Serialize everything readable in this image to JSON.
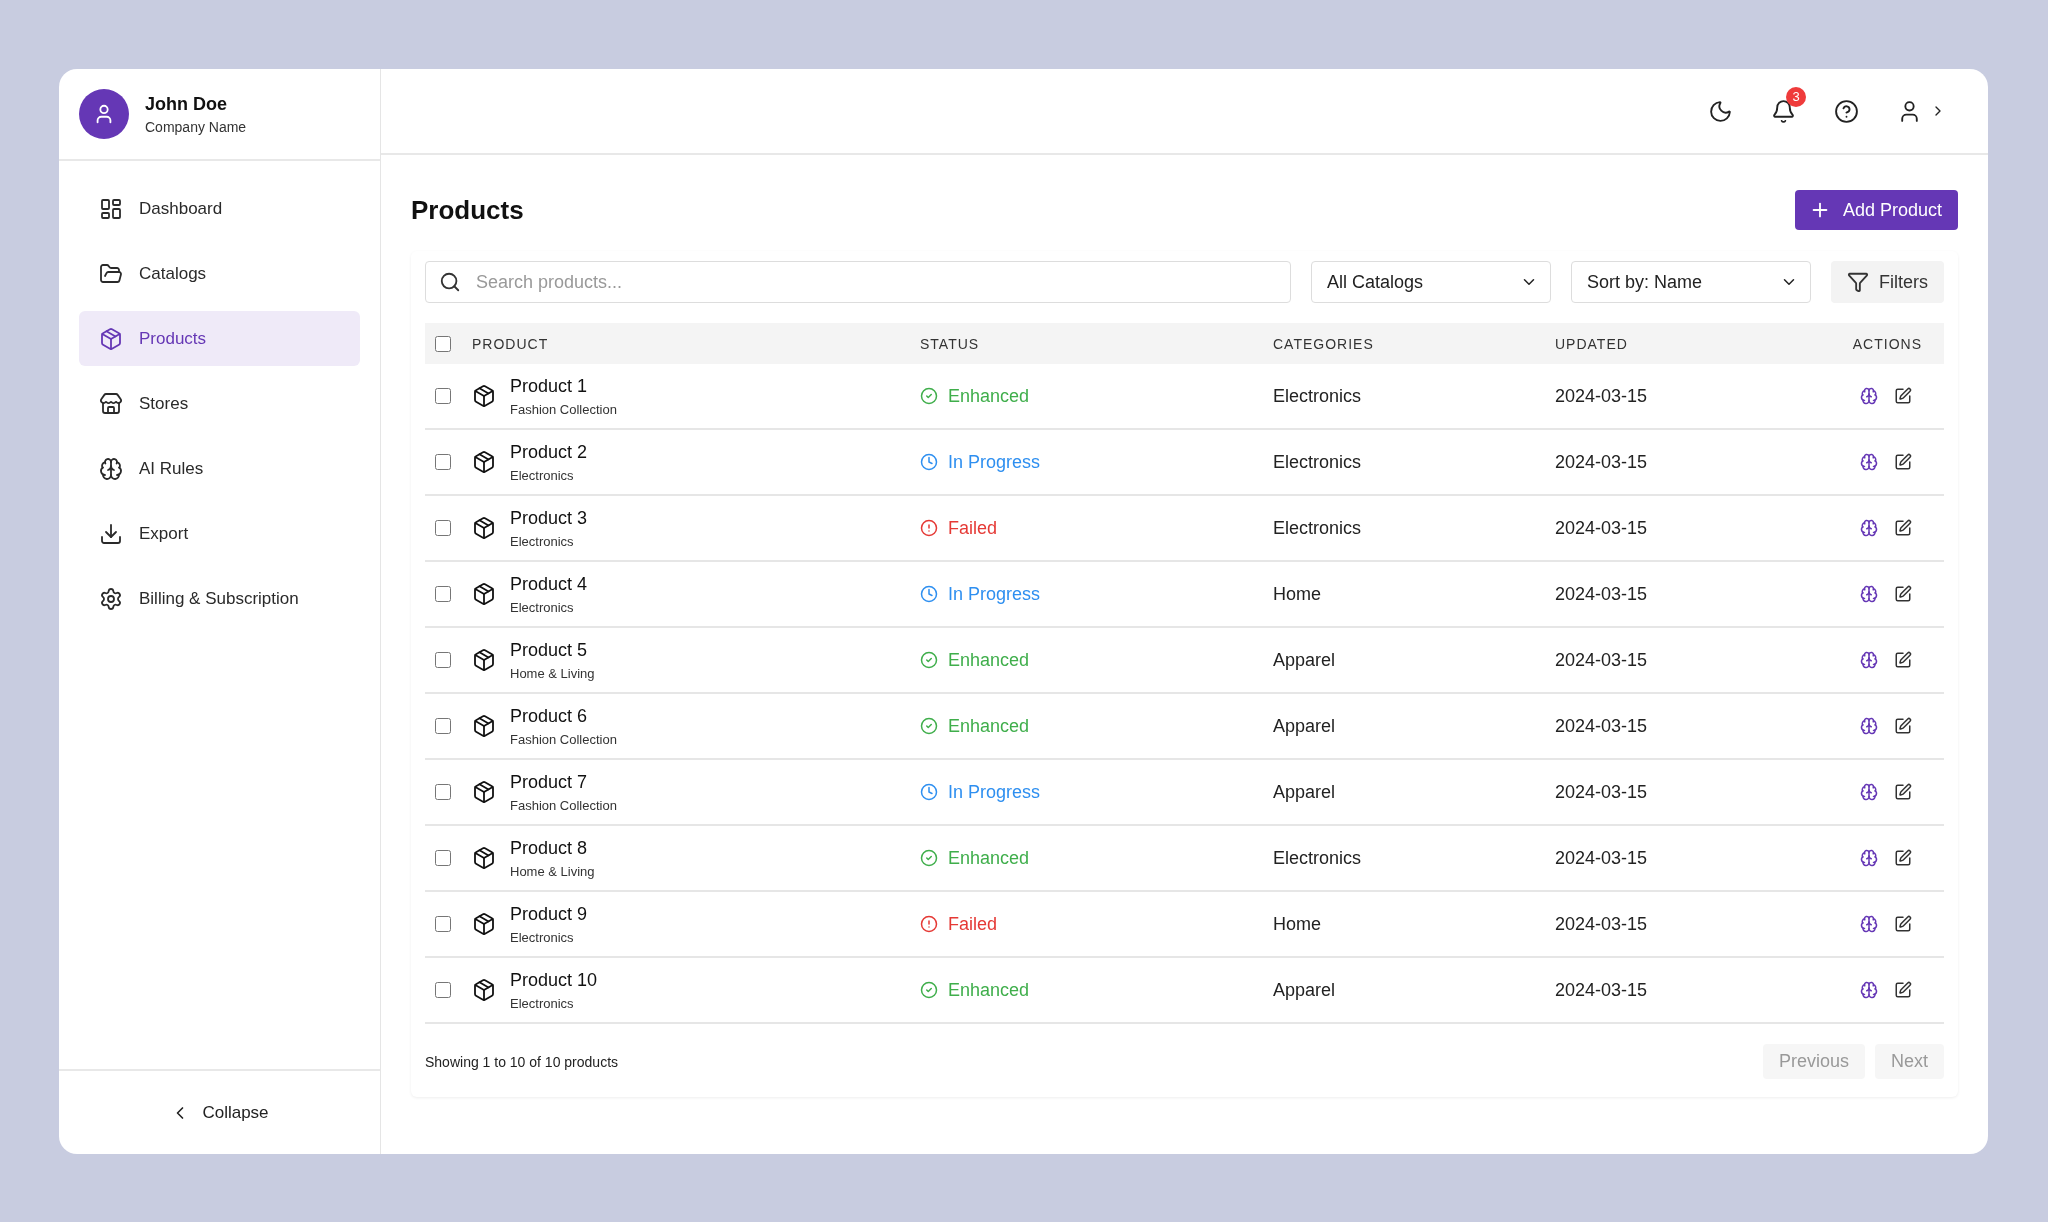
{
  "user": {
    "name": "John Doe",
    "company": "Company Name"
  },
  "sidebar": {
    "items": [
      {
        "label": "Dashboard",
        "selected": false
      },
      {
        "label": "Catalogs",
        "selected": false
      },
      {
        "label": "Products",
        "selected": true
      },
      {
        "label": "Stores",
        "selected": false
      },
      {
        "label": "AI Rules",
        "selected": false
      },
      {
        "label": "Export",
        "selected": false
      },
      {
        "label": "Billing & Subscription",
        "selected": false
      }
    ],
    "collapse": "Collapse"
  },
  "header": {
    "notifications": "3"
  },
  "page": {
    "title": "Products",
    "add_button": "Add Product"
  },
  "filters": {
    "search_placeholder": "Search products...",
    "catalog": "All Catalogs",
    "sort": "Sort by: Name",
    "filters_button": "Filters"
  },
  "table": {
    "select_all_checked": false,
    "columns": [
      "PRODUCT",
      "STATUS",
      "CATEGORIES",
      "UPDATED",
      "ACTIONS"
    ],
    "rows": [
      {
        "name": "Product 1",
        "collection": "Fashion Collection",
        "status": "Enhanced",
        "kind": "enhanced",
        "category": "Electronics",
        "updated": "2024-03-15",
        "checked": false
      },
      {
        "name": "Product 2",
        "collection": "Electronics",
        "status": "In Progress",
        "kind": "progress",
        "category": "Electronics",
        "updated": "2024-03-15",
        "checked": false
      },
      {
        "name": "Product 3",
        "collection": "Electronics",
        "status": "Failed",
        "kind": "failed",
        "category": "Electronics",
        "updated": "2024-03-15",
        "checked": false
      },
      {
        "name": "Product 4",
        "collection": "Electronics",
        "status": "In Progress",
        "kind": "progress",
        "category": "Home",
        "updated": "2024-03-15",
        "checked": false
      },
      {
        "name": "Product 5",
        "collection": "Home & Living",
        "status": "Enhanced",
        "kind": "enhanced",
        "category": "Apparel",
        "updated": "2024-03-15",
        "checked": false
      },
      {
        "name": "Product 6",
        "collection": "Fashion Collection",
        "status": "Enhanced",
        "kind": "enhanced",
        "category": "Apparel",
        "updated": "2024-03-15",
        "checked": false
      },
      {
        "name": "Product 7",
        "collection": "Fashion Collection",
        "status": "In Progress",
        "kind": "progress",
        "category": "Apparel",
        "updated": "2024-03-15",
        "checked": false
      },
      {
        "name": "Product 8",
        "collection": "Home & Living",
        "status": "Enhanced",
        "kind": "enhanced",
        "category": "Electronics",
        "updated": "2024-03-15",
        "checked": false
      },
      {
        "name": "Product 9",
        "collection": "Electronics",
        "status": "Failed",
        "kind": "failed",
        "category": "Home",
        "updated": "2024-03-15",
        "checked": false
      },
      {
        "name": "Product 10",
        "collection": "Electronics",
        "status": "Enhanced",
        "kind": "enhanced",
        "category": "Apparel",
        "updated": "2024-03-15",
        "checked": false
      }
    ]
  },
  "pagination": {
    "summary": "Showing 1 to 10 of 10 products",
    "previous": {
      "label": "Previous",
      "disabled": true
    },
    "next": {
      "label": "Next",
      "disabled": true
    }
  }
}
